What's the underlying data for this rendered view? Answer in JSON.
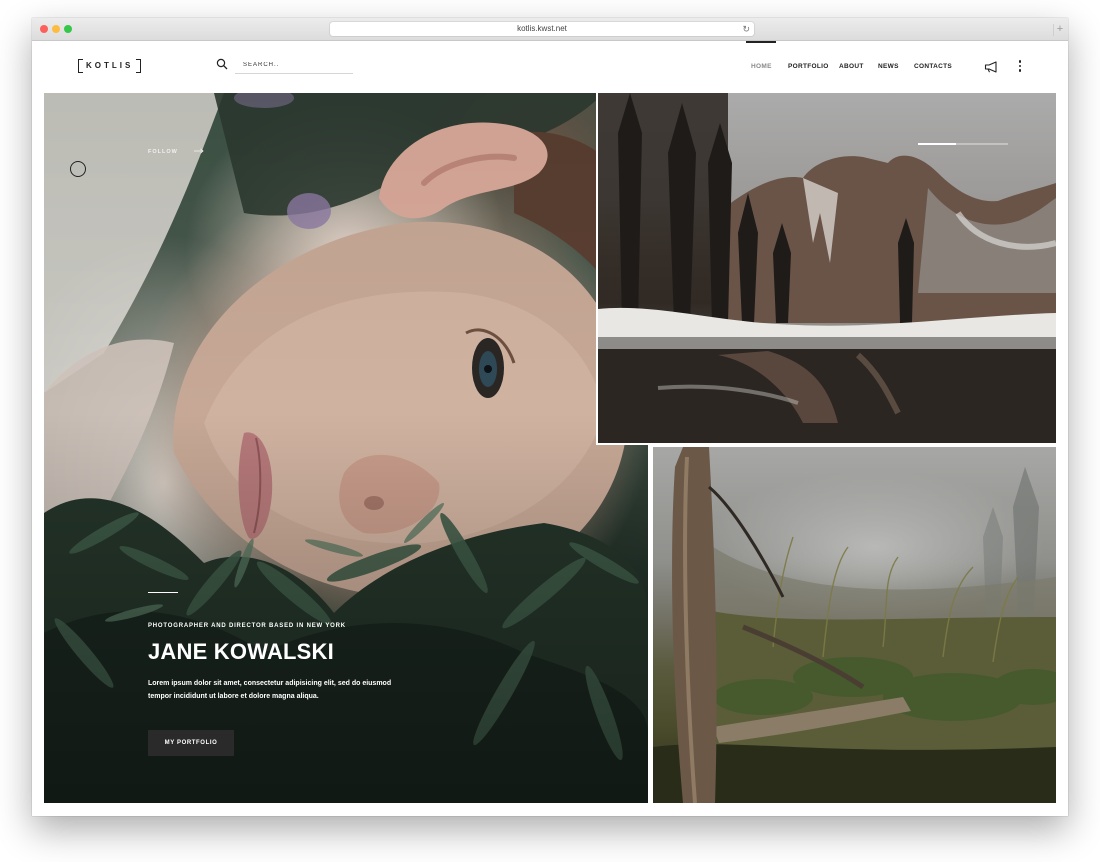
{
  "browser": {
    "url": "kotlis.kwst.net",
    "reload_icon": "reload-icon",
    "new_tab_label": "+"
  },
  "header": {
    "logo": "KOTLIS",
    "search": {
      "placeholder": "SEARCH..",
      "value": "",
      "icon": "search-icon"
    },
    "nav": [
      {
        "label": "HOME",
        "active": true
      },
      {
        "label": "PORTFOLIO",
        "active": false
      },
      {
        "label": "ABOUT",
        "active": false
      },
      {
        "label": "NEWS",
        "active": false
      },
      {
        "label": "CONTACTS",
        "active": false
      }
    ],
    "icons": [
      "megaphone-icon",
      "more-vertical-icon"
    ]
  },
  "hero": {
    "follow_label": "FOLLOW",
    "subtitle": "PHOTOGRAPHER AND DIRECTOR BASED IN NEW YORK",
    "name": "JANE KOWALSKI",
    "description": "Lorem ipsum dolor sit amet, consectetur adipisicing elit, sed do eiusmod tempor incididunt ut labore et dolore magna aliqua.",
    "button_label": "MY PORTFOLIO"
  },
  "colors": {
    "text_dark": "#222222",
    "button_bg": "#2a2a2a",
    "nav_active": "#888888"
  }
}
